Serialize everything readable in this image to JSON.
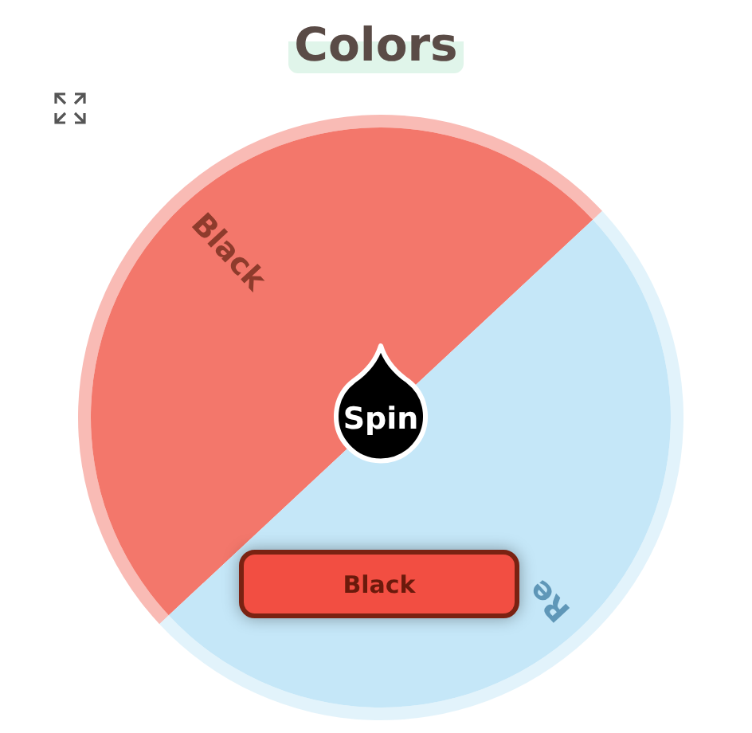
{
  "title": "Colors",
  "wheel": {
    "segments": [
      {
        "label": "Black",
        "color": "#f3776b"
      },
      {
        "label": "Re",
        "color": "#c5e7f8"
      }
    ],
    "center_label": "Spin"
  },
  "result_button": "Black"
}
